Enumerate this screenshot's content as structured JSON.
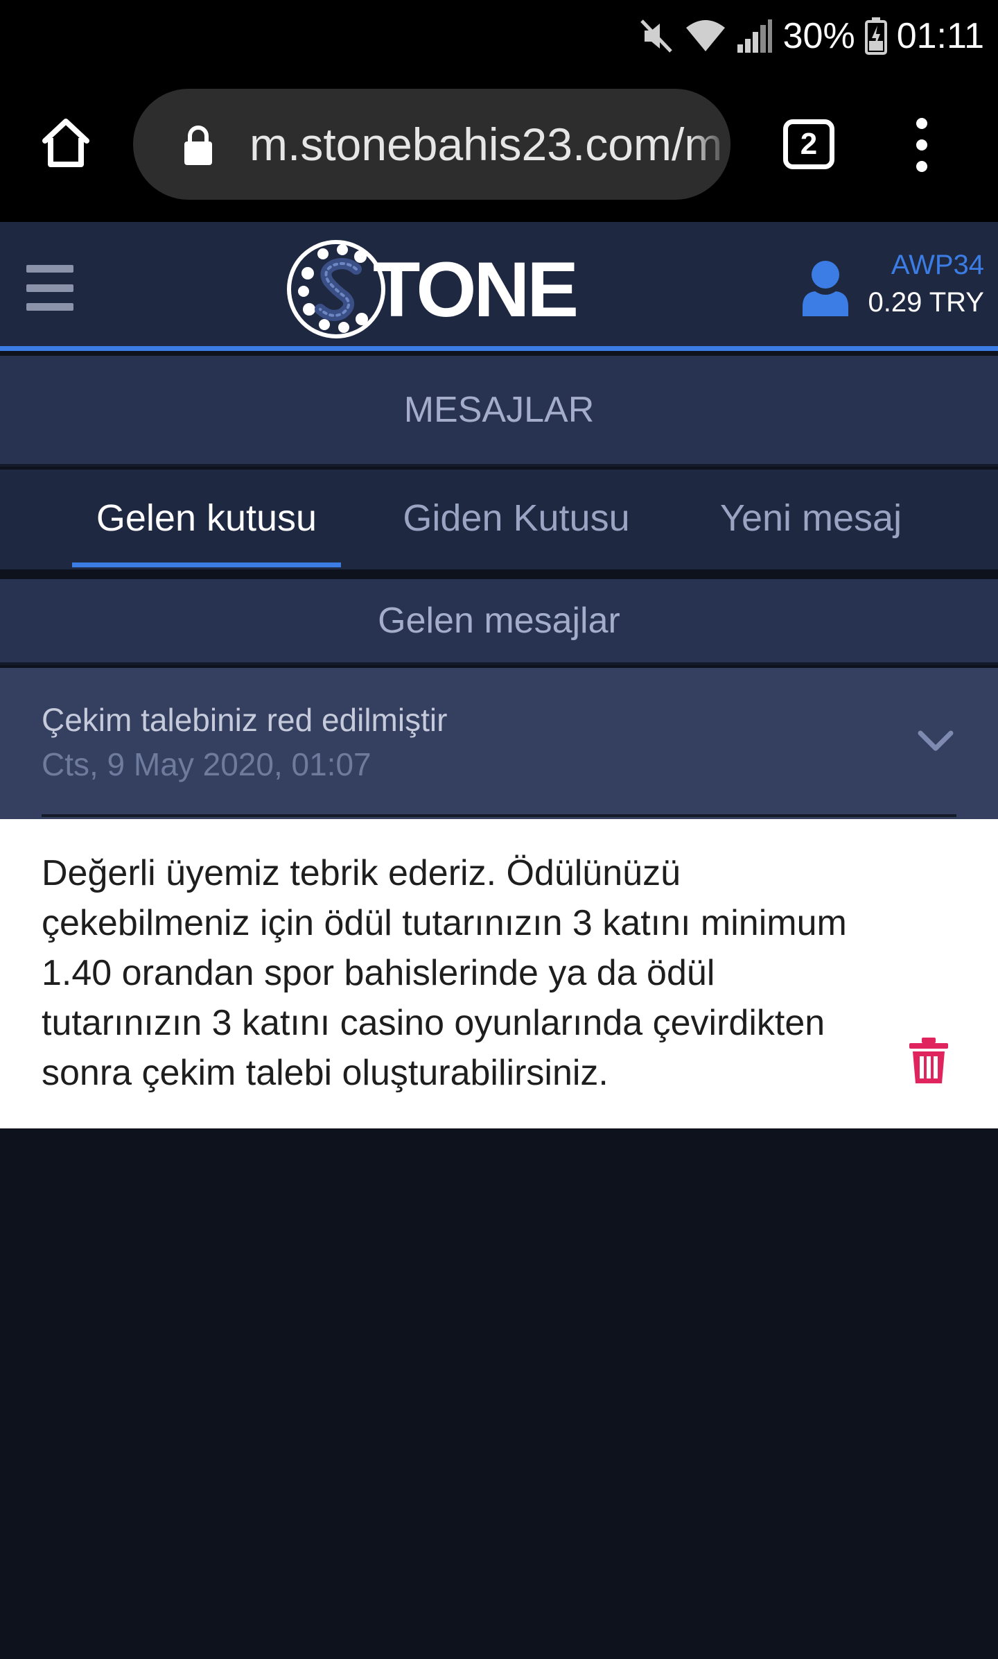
{
  "status_bar": {
    "battery": "30%",
    "time": "01:11"
  },
  "browser": {
    "url": "m.stonebahis23.com/m",
    "tab_count": "2"
  },
  "header": {
    "logo_text": "TONE",
    "username": "AWP34",
    "balance": "0.29 TRY"
  },
  "page": {
    "title": "MESAJLAR"
  },
  "tabs": [
    {
      "label": "Gelen kutusu",
      "active": true
    },
    {
      "label": "Giden Kutusu",
      "active": false
    },
    {
      "label": "Yeni mesaj",
      "active": false
    }
  ],
  "section": {
    "title": "Gelen mesajlar"
  },
  "message": {
    "subject": "Çekim talebiniz red edilmiştir",
    "date": "Cts, 9 May 2020, 01:07",
    "body": "Değerli üyemiz tebrik ederiz. Ödülünüzü çekebilmeniz için ödül tutarınızın 3 katını minimum 1.40 orandan spor bahislerinde ya da ödül tutarınızın 3 katını casino oyunlarında çevirdikten sonra çekim talebi oluşturabilirsiniz."
  },
  "colors": {
    "accent": "#3b7de5",
    "delete": "#e0245e",
    "header_bg": "#1f2841",
    "page_bg": "#0e121c"
  }
}
